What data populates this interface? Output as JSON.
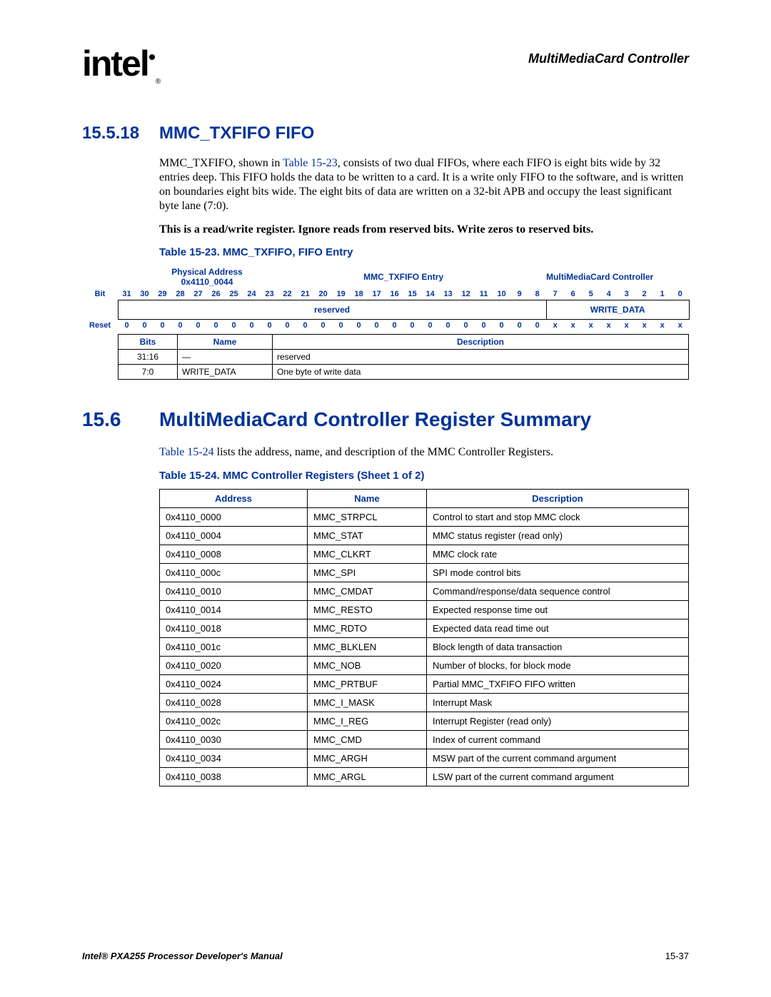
{
  "header": {
    "logo_text": "intel",
    "section_title": "MultiMediaCard Controller"
  },
  "sec1": {
    "number": "15.5.18",
    "title": "MMC_TXFIFO FIFO",
    "para_pre": "MMC_TXFIFO, shown in ",
    "para_link": "Table 15-23",
    "para_post": ", consists of two dual FIFOs, where each FIFO is eight bits wide by 32 entries deep. This FIFO holds the data to be written to a card. It is a write only FIFO to the software, and is written on boundaries eight bits wide. The eight bits of data are written on a 32-bit APB and occupy the least significant byte lane (7:0).",
    "note": "This is a read/write register. Ignore reads from reserved bits. Write zeros to reserved bits.",
    "table_caption": "Table 15-23. MMC_TXFIFO, FIFO Entry"
  },
  "regtable": {
    "phys_label": "Physical Address",
    "phys_value": "0x4110_0044",
    "entry_label": "MMC_TXFIFO Entry",
    "controller_label": "MultiMediaCard Controller",
    "bit_label": "Bit",
    "bits": [
      "31",
      "30",
      "29",
      "28",
      "27",
      "26",
      "25",
      "24",
      "23",
      "22",
      "21",
      "20",
      "19",
      "18",
      "17",
      "16",
      "15",
      "14",
      "13",
      "12",
      "11",
      "10",
      "9",
      "8",
      "7",
      "6",
      "5",
      "4",
      "3",
      "2",
      "1",
      "0"
    ],
    "field_reserved": "reserved",
    "field_write": "WRITE_DATA",
    "reset_label": "Reset",
    "reset": [
      "0",
      "0",
      "0",
      "0",
      "0",
      "0",
      "0",
      "0",
      "0",
      "0",
      "0",
      "0",
      "0",
      "0",
      "0",
      "0",
      "0",
      "0",
      "0",
      "0",
      "0",
      "0",
      "0",
      "0",
      "x",
      "x",
      "x",
      "x",
      "x",
      "x",
      "x",
      "x"
    ],
    "cols": {
      "bits": "Bits",
      "name": "Name",
      "desc": "Description"
    },
    "rows": [
      {
        "bits": "31:16",
        "name": "—",
        "desc": "reserved"
      },
      {
        "bits": "7:0",
        "name": "WRITE_DATA",
        "desc": "One byte of write data"
      }
    ]
  },
  "sec2": {
    "number": "15.6",
    "title": "MultiMediaCard Controller Register Summary",
    "para_link": "Table 15-24",
    "para_post": " lists the address, name, and description of the MMC Controller Registers.",
    "table_caption": "Table 15-24. MMC Controller Registers (Sheet 1 of 2)"
  },
  "summary": {
    "cols": {
      "addr": "Address",
      "name": "Name",
      "desc": "Description"
    },
    "rows": [
      {
        "addr": "0x4110_0000",
        "name": "MMC_STRPCL",
        "desc": "Control to start and stop MMC clock"
      },
      {
        "addr": "0x4110_0004",
        "name": "MMC_STAT",
        "desc": "MMC status register (read only)"
      },
      {
        "addr": "0x4110_0008",
        "name": "MMC_CLKRT",
        "desc": "MMC clock rate"
      },
      {
        "addr": "0x4110_000c",
        "name": "MMC_SPI",
        "desc": "SPI mode control bits"
      },
      {
        "addr": "0x4110_0010",
        "name": "MMC_CMDAT",
        "desc": "Command/response/data sequence control"
      },
      {
        "addr": "0x4110_0014",
        "name": "MMC_RESTO",
        "desc": "Expected response time out"
      },
      {
        "addr": "0x4110_0018",
        "name": "MMC_RDTO",
        "desc": "Expected data read time out"
      },
      {
        "addr": "0x4110_001c",
        "name": "MMC_BLKLEN",
        "desc": "Block length of data transaction"
      },
      {
        "addr": "0x4110_0020",
        "name": "MMC_NOB",
        "desc": "Number of blocks, for block mode"
      },
      {
        "addr": "0x4110_0024",
        "name": "MMC_PRTBUF",
        "desc": "Partial MMC_TXFIFO FIFO written"
      },
      {
        "addr": "0x4110_0028",
        "name": "MMC_I_MASK",
        "desc": "Interrupt Mask"
      },
      {
        "addr": "0x4110_002c",
        "name": "MMC_I_REG",
        "desc": "Interrupt Register (read only)"
      },
      {
        "addr": "0x4110_0030",
        "name": "MMC_CMD",
        "desc": "Index of current command"
      },
      {
        "addr": "0x4110_0034",
        "name": "MMC_ARGH",
        "desc": "MSW part of the current command argument"
      },
      {
        "addr": "0x4110_0038",
        "name": "MMC_ARGL",
        "desc": "LSW part of the current command argument"
      }
    ]
  },
  "footer": {
    "left": "Intel® PXA255 Processor Developer's Manual",
    "right": "15-37"
  }
}
